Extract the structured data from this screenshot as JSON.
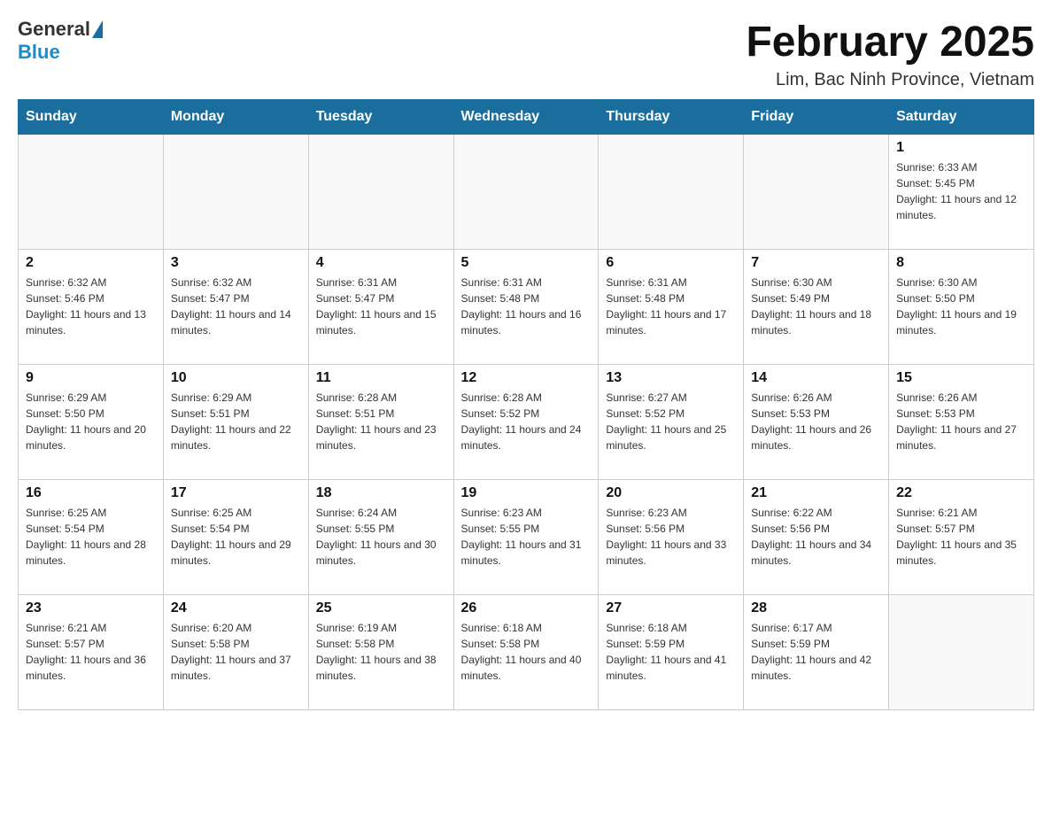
{
  "header": {
    "logo_general": "General",
    "logo_blue": "Blue",
    "title": "February 2025",
    "location": "Lim, Bac Ninh Province, Vietnam"
  },
  "days_of_week": [
    "Sunday",
    "Monday",
    "Tuesday",
    "Wednesday",
    "Thursday",
    "Friday",
    "Saturday"
  ],
  "weeks": [
    [
      {
        "day": "",
        "info": ""
      },
      {
        "day": "",
        "info": ""
      },
      {
        "day": "",
        "info": ""
      },
      {
        "day": "",
        "info": ""
      },
      {
        "day": "",
        "info": ""
      },
      {
        "day": "",
        "info": ""
      },
      {
        "day": "1",
        "info": "Sunrise: 6:33 AM\nSunset: 5:45 PM\nDaylight: 11 hours and 12 minutes."
      }
    ],
    [
      {
        "day": "2",
        "info": "Sunrise: 6:32 AM\nSunset: 5:46 PM\nDaylight: 11 hours and 13 minutes."
      },
      {
        "day": "3",
        "info": "Sunrise: 6:32 AM\nSunset: 5:47 PM\nDaylight: 11 hours and 14 minutes."
      },
      {
        "day": "4",
        "info": "Sunrise: 6:31 AM\nSunset: 5:47 PM\nDaylight: 11 hours and 15 minutes."
      },
      {
        "day": "5",
        "info": "Sunrise: 6:31 AM\nSunset: 5:48 PM\nDaylight: 11 hours and 16 minutes."
      },
      {
        "day": "6",
        "info": "Sunrise: 6:31 AM\nSunset: 5:48 PM\nDaylight: 11 hours and 17 minutes."
      },
      {
        "day": "7",
        "info": "Sunrise: 6:30 AM\nSunset: 5:49 PM\nDaylight: 11 hours and 18 minutes."
      },
      {
        "day": "8",
        "info": "Sunrise: 6:30 AM\nSunset: 5:50 PM\nDaylight: 11 hours and 19 minutes."
      }
    ],
    [
      {
        "day": "9",
        "info": "Sunrise: 6:29 AM\nSunset: 5:50 PM\nDaylight: 11 hours and 20 minutes."
      },
      {
        "day": "10",
        "info": "Sunrise: 6:29 AM\nSunset: 5:51 PM\nDaylight: 11 hours and 22 minutes."
      },
      {
        "day": "11",
        "info": "Sunrise: 6:28 AM\nSunset: 5:51 PM\nDaylight: 11 hours and 23 minutes."
      },
      {
        "day": "12",
        "info": "Sunrise: 6:28 AM\nSunset: 5:52 PM\nDaylight: 11 hours and 24 minutes."
      },
      {
        "day": "13",
        "info": "Sunrise: 6:27 AM\nSunset: 5:52 PM\nDaylight: 11 hours and 25 minutes."
      },
      {
        "day": "14",
        "info": "Sunrise: 6:26 AM\nSunset: 5:53 PM\nDaylight: 11 hours and 26 minutes."
      },
      {
        "day": "15",
        "info": "Sunrise: 6:26 AM\nSunset: 5:53 PM\nDaylight: 11 hours and 27 minutes."
      }
    ],
    [
      {
        "day": "16",
        "info": "Sunrise: 6:25 AM\nSunset: 5:54 PM\nDaylight: 11 hours and 28 minutes."
      },
      {
        "day": "17",
        "info": "Sunrise: 6:25 AM\nSunset: 5:54 PM\nDaylight: 11 hours and 29 minutes."
      },
      {
        "day": "18",
        "info": "Sunrise: 6:24 AM\nSunset: 5:55 PM\nDaylight: 11 hours and 30 minutes."
      },
      {
        "day": "19",
        "info": "Sunrise: 6:23 AM\nSunset: 5:55 PM\nDaylight: 11 hours and 31 minutes."
      },
      {
        "day": "20",
        "info": "Sunrise: 6:23 AM\nSunset: 5:56 PM\nDaylight: 11 hours and 33 minutes."
      },
      {
        "day": "21",
        "info": "Sunrise: 6:22 AM\nSunset: 5:56 PM\nDaylight: 11 hours and 34 minutes."
      },
      {
        "day": "22",
        "info": "Sunrise: 6:21 AM\nSunset: 5:57 PM\nDaylight: 11 hours and 35 minutes."
      }
    ],
    [
      {
        "day": "23",
        "info": "Sunrise: 6:21 AM\nSunset: 5:57 PM\nDaylight: 11 hours and 36 minutes."
      },
      {
        "day": "24",
        "info": "Sunrise: 6:20 AM\nSunset: 5:58 PM\nDaylight: 11 hours and 37 minutes."
      },
      {
        "day": "25",
        "info": "Sunrise: 6:19 AM\nSunset: 5:58 PM\nDaylight: 11 hours and 38 minutes."
      },
      {
        "day": "26",
        "info": "Sunrise: 6:18 AM\nSunset: 5:58 PM\nDaylight: 11 hours and 40 minutes."
      },
      {
        "day": "27",
        "info": "Sunrise: 6:18 AM\nSunset: 5:59 PM\nDaylight: 11 hours and 41 minutes."
      },
      {
        "day": "28",
        "info": "Sunrise: 6:17 AM\nSunset: 5:59 PM\nDaylight: 11 hours and 42 minutes."
      },
      {
        "day": "",
        "info": ""
      }
    ]
  ]
}
